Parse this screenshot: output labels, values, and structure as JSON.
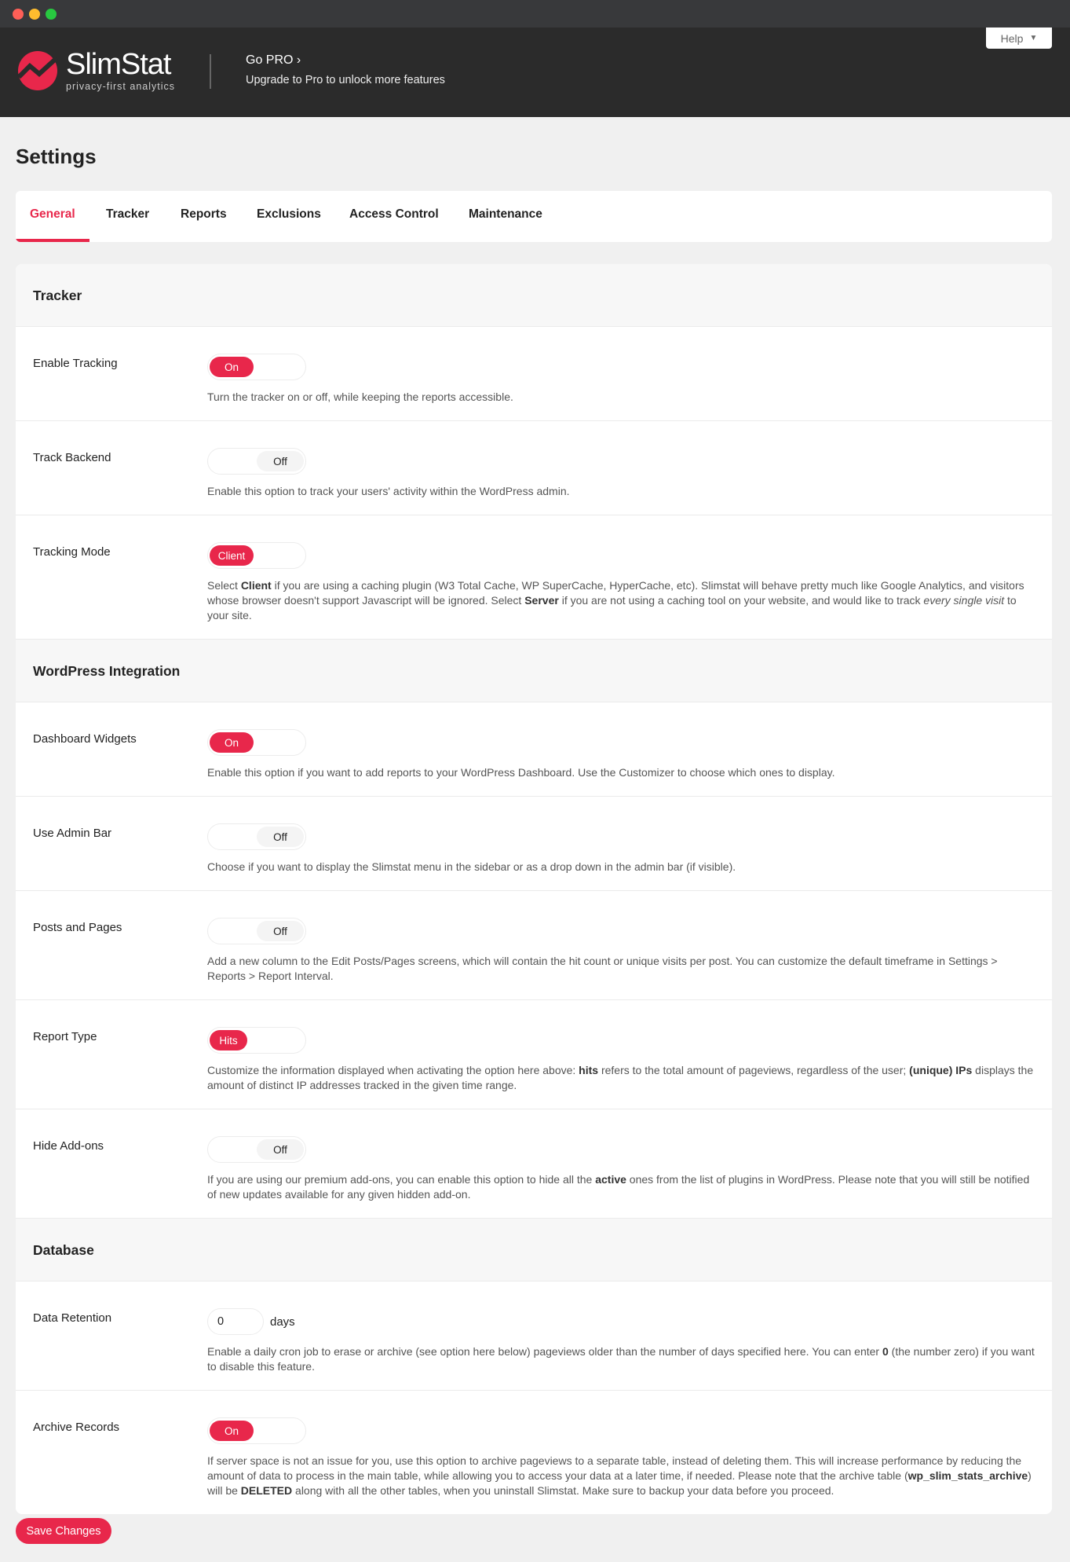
{
  "header": {
    "brand": "SlimStat",
    "tagline": "privacy-first analytics",
    "go_pro": "Go PRO",
    "go_pro_sub": "Upgrade to Pro to unlock more features",
    "help": "Help",
    "accent": "#e8274b"
  },
  "page_title": "Settings",
  "tabs": [
    {
      "label": "General",
      "active": true
    },
    {
      "label": "Tracker"
    },
    {
      "label": "Reports"
    },
    {
      "label": "Exclusions"
    },
    {
      "label": "Access Control"
    },
    {
      "label": "Maintenance"
    }
  ],
  "sections": {
    "tracker": {
      "title": "Tracker",
      "enable_tracking": {
        "label": "Enable Tracking",
        "value": "On",
        "desc": [
          "Turn the tracker on or off, while keeping the reports accessible."
        ]
      },
      "track_backend": {
        "label": "Track Backend",
        "value": "Off",
        "desc": [
          "Enable this option to track your users' activity within the WordPress admin."
        ]
      },
      "tracking_mode": {
        "label": "Tracking Mode",
        "value": "Client",
        "desc": [
          "Select ",
          "Client",
          " if you are using a caching plugin (W3 Total Cache, WP SuperCache, HyperCache, etc). Slimstat will behave pretty much like Google Analytics, and visitors whose browser doesn't support Javascript will be ignored. Select ",
          "Server",
          " if you are not using a caching tool on your website, and would like to track ",
          "every single visit",
          " to your site."
        ]
      }
    },
    "wp": {
      "title": "WordPress Integration",
      "dashboard_widgets": {
        "label": "Dashboard Widgets",
        "value": "On",
        "desc": [
          "Enable this option if you want to add reports to your WordPress Dashboard. Use the Customizer to choose which ones to display."
        ]
      },
      "admin_bar": {
        "label": "Use Admin Bar",
        "value": "Off",
        "desc": [
          "Choose if you want to display the Slimstat menu in the sidebar or as a drop down in the admin bar (if visible)."
        ]
      },
      "posts_pages": {
        "label": "Posts and Pages",
        "value": "Off",
        "desc": [
          "Add a new column to the Edit Posts/Pages screens, which will contain the hit count or unique visits per post. You can customize the default timeframe in Settings > Reports > Report Interval."
        ]
      },
      "report_type": {
        "label": "Report Type",
        "value": "Hits",
        "desc": [
          "Customize the information displayed when activating the option here above: ",
          "hits",
          " refers to the total amount of pageviews, regardless of the user; ",
          "(unique) IPs",
          " displays the amount of distinct IP addresses tracked in the given time range."
        ]
      },
      "hide_addons": {
        "label": "Hide Add-ons",
        "value": "Off",
        "desc": [
          "If you are using our premium add-ons, you can enable this option to hide all the ",
          "active",
          " ones from the list of plugins in WordPress. Please note that you will still be notified of new updates available for any given hidden add-on."
        ]
      }
    },
    "db": {
      "title": "Database",
      "retention": {
        "label": "Data Retention",
        "value": "0",
        "unit": "days",
        "desc": [
          "Enable a daily cron job to erase or archive (see option here below) pageviews older than the number of days specified here. You can enter ",
          "0",
          " (the number zero) if you want to disable this feature."
        ]
      },
      "archive": {
        "label": "Archive Records",
        "value": "On",
        "desc": [
          "If server space is not an issue for you, use this option to archive pageviews to a separate table, instead of deleting them. This will increase performance by reducing the amount of data to process in the main table, while allowing you to access your data at a later time, if needed. Please note that the archive table (",
          "wp_slim_stats_archive",
          ") will be ",
          "DELETED",
          " along with all the other tables, when you uninstall Slimstat. Make sure to backup your data before you proceed."
        ]
      }
    }
  },
  "save_label": "Save Changes"
}
